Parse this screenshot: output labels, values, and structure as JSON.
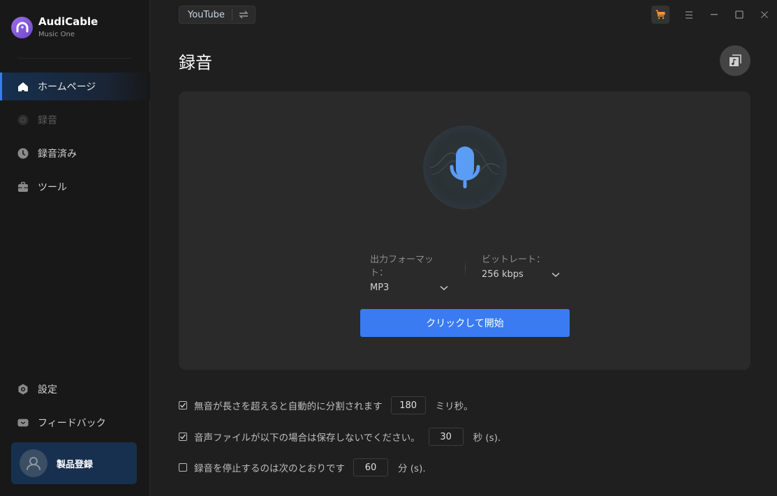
{
  "app": {
    "name": "AudiCable",
    "subtitle": "Music One",
    "accent_color": "#3a7bf2",
    "logo_color": "#8b5ddc"
  },
  "sidebar": {
    "items": [
      {
        "label": "ホームページ",
        "icon": "home-icon",
        "active": true
      },
      {
        "label": "録音",
        "icon": "record-icon",
        "disabled": true
      },
      {
        "label": "録音済み",
        "icon": "clock-icon"
      },
      {
        "label": "ツール",
        "icon": "toolbox-icon"
      }
    ],
    "bottom_items": [
      {
        "label": "設定",
        "icon": "settings-icon"
      },
      {
        "label": "フィードバック",
        "icon": "mail-icon"
      }
    ],
    "register_label": "製品登録"
  },
  "topbar": {
    "source": "YouTube",
    "swap_icon": "swap-icon",
    "cart_color": "#f0943a"
  },
  "main": {
    "title": "録音",
    "format": {
      "label": "出力フォーマット：",
      "value": "MP3"
    },
    "bitrate": {
      "label": "ビットレート：",
      "value": "256 kbps"
    },
    "start_button": "クリックして開始"
  },
  "options": [
    {
      "checked": true,
      "label": "無音が長さを超えると自動的に分割されます",
      "value": "180",
      "unit": "ミリ秒。"
    },
    {
      "checked": true,
      "label": "音声ファイルが以下の場合は保存しないでください。",
      "value": "30",
      "unit": "秒 (s)."
    },
    {
      "checked": false,
      "label": "録音を停止するのは次のとおりです",
      "value": "60",
      "unit": "分 (s)."
    }
  ]
}
